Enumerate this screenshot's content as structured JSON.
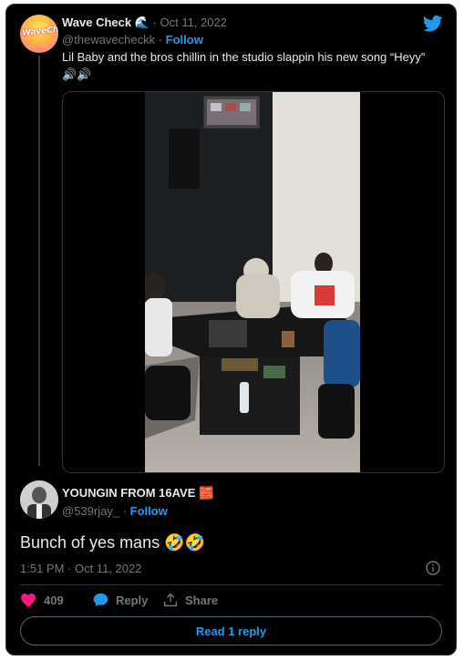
{
  "tweet": {
    "display_name": "Wave Check",
    "wave_emoji": "🌊",
    "separator": "·",
    "date": "Oct 11, 2022",
    "handle": "@thewavecheckk",
    "follow_label": "Follow",
    "text": "Lil Baby and the bros chillin in the studio slappin his new song “Heyy”",
    "speaker_emojis": "🔊🔊",
    "avatar_text": "WaveCheck"
  },
  "reply": {
    "display_name": "YOUNGIN FROM 16AVE",
    "brick_emoji": "🧱",
    "handle": "@539rjay_",
    "separator": "·",
    "follow_label": "Follow",
    "text": "Bunch of yes mans",
    "text_emojis": "🤣🤣",
    "timestamp": "1:51 PM · Oct 11, 2022"
  },
  "actions": {
    "like_count": "409",
    "reply_label": "Reply",
    "share_label": "Share"
  },
  "read_reply_label": "Read 1 reply",
  "colors": {
    "background": "#000000",
    "link_blue": "#1d9bf0",
    "muted": "#71767b",
    "like_pink": "#f91880"
  }
}
